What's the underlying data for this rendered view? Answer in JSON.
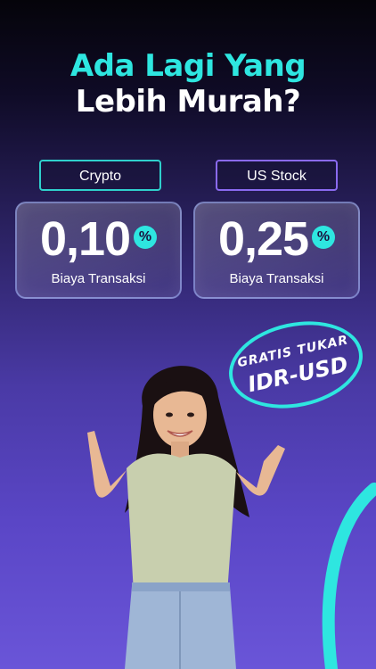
{
  "headline": {
    "line1": "Ada Lagi Yang",
    "line2": "Lebih Murah?"
  },
  "crypto": {
    "tag": "Crypto",
    "rate": "0,10",
    "unit": "%",
    "label": "Biaya Transaksi"
  },
  "stock": {
    "tag": "US Stock",
    "rate": "0,25",
    "unit": "%",
    "label": "Biaya Transaksi"
  },
  "badge": {
    "line1": "GRATIS TUKAR",
    "line2": "IDR-USD"
  },
  "colors": {
    "accent": "#2ee6e0",
    "purple": "#8a6af0",
    "text": "#ffffff"
  }
}
